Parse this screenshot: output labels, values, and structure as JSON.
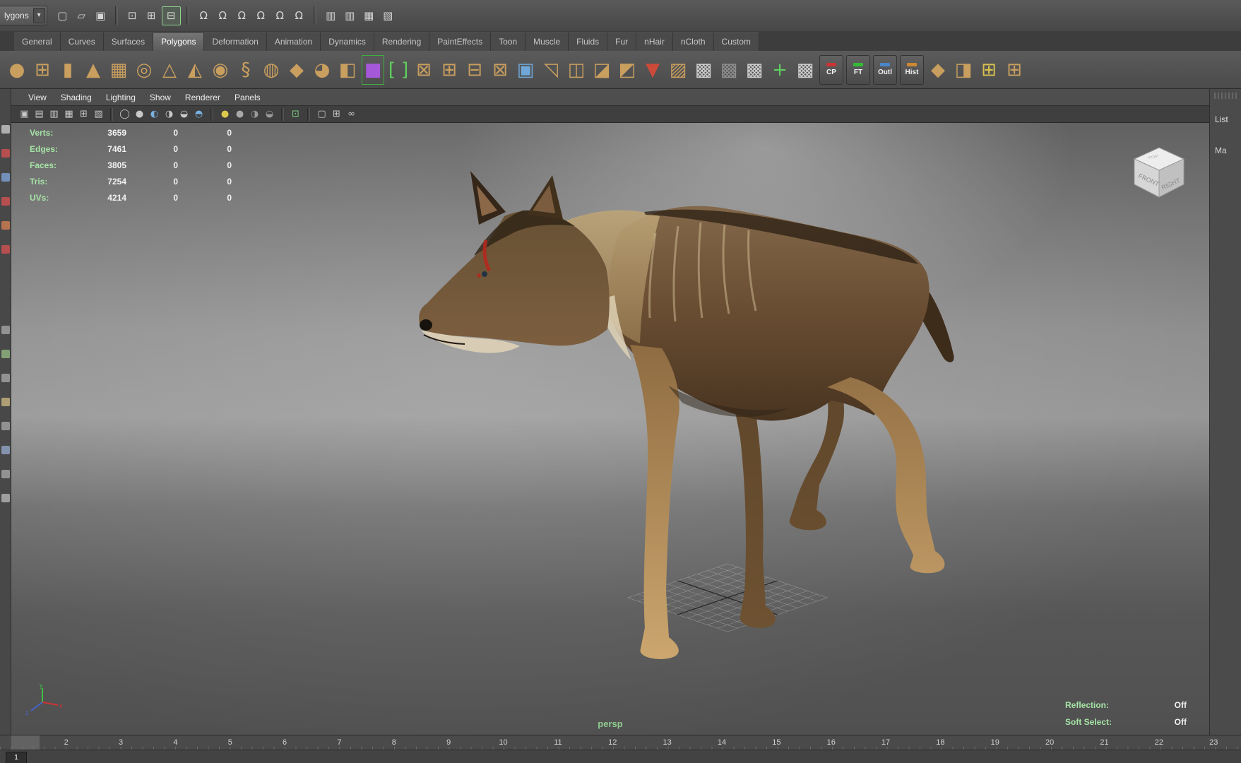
{
  "toolbar": {
    "menu_set_visible": "lygons",
    "menu_arrow": "▾",
    "groups": [
      {
        "icons": [
          {
            "name": "new-scene-icon",
            "glyph": "▢"
          },
          {
            "name": "open-scene-icon",
            "glyph": "▱"
          },
          {
            "name": "save-scene-icon",
            "glyph": "▣"
          }
        ]
      },
      {
        "icons": [
          {
            "name": "select-hierarchy-icon",
            "glyph": "⊡"
          },
          {
            "name": "select-object-icon",
            "glyph": "⊞"
          },
          {
            "name": "select-component-icon",
            "glyph": "⊟",
            "boxed": true
          }
        ]
      },
      {
        "icons": [
          {
            "name": "snap-grid-icon",
            "glyph": "Ω"
          },
          {
            "name": "snap-curve-icon",
            "glyph": "Ω"
          },
          {
            "name": "snap-point-icon",
            "glyph": "Ω"
          },
          {
            "name": "snap-projected-center-icon",
            "glyph": "Ω"
          },
          {
            "name": "snap-view-plane-icon",
            "glyph": "Ω"
          },
          {
            "name": "make-live-icon",
            "glyph": "Ω"
          }
        ]
      },
      {
        "icons": [
          {
            "name": "input-connections-icon",
            "glyph": "▥"
          },
          {
            "name": "output-connections-icon",
            "glyph": "▥"
          },
          {
            "name": "construction-history-icon",
            "glyph": "▦"
          },
          {
            "name": "render-view-icon",
            "glyph": "▧"
          }
        ]
      }
    ]
  },
  "shelf": {
    "tabs": [
      "General",
      "Curves",
      "Surfaces",
      "Polygons",
      "Deformation",
      "Animation",
      "Dynamics",
      "Rendering",
      "PaintEffects",
      "Toon",
      "Muscle",
      "Fluids",
      "Fur",
      "nHair",
      "nCloth",
      "Custom"
    ],
    "active_tab": "Polygons",
    "default_icon_color": "#c99f5f",
    "icons": [
      {
        "name": "poly-sphere-icon",
        "glyph": "●"
      },
      {
        "name": "poly-cube-icon",
        "glyph": "⊞"
      },
      {
        "name": "poly-cylinder-icon",
        "glyph": "▮"
      },
      {
        "name": "poly-cone-icon",
        "glyph": "▲"
      },
      {
        "name": "poly-plane-icon",
        "glyph": "▦"
      },
      {
        "name": "poly-torus-icon",
        "glyph": "◎"
      },
      {
        "name": "poly-prism-icon",
        "glyph": "△"
      },
      {
        "name": "poly-pyramid-icon",
        "glyph": "◭"
      },
      {
        "name": "poly-pipe-icon",
        "glyph": "◉"
      },
      {
        "name": "poly-helix-icon",
        "glyph": "§"
      },
      {
        "name": "poly-soccer-ball-icon",
        "glyph": "◍"
      },
      {
        "name": "poly-platonic-icon",
        "glyph": "◆"
      },
      {
        "name": "sculpt-tool-icon",
        "glyph": "◕"
      },
      {
        "name": "poly-mirror-icon",
        "glyph": "◧"
      },
      {
        "name": "poly-texture-cube-icon",
        "glyph": "■",
        "color": "#a558d8",
        "highlight": true
      },
      {
        "name": "poly-brackets-icon",
        "glyph": "[ ]",
        "color": "#5ecf5e"
      },
      {
        "name": "select-cube-icon",
        "glyph": "⊠"
      },
      {
        "name": "poly-combine-icon",
        "glyph": "⊞"
      },
      {
        "name": "poly-separate-icon",
        "glyph": "⊟"
      },
      {
        "name": "poly-extract-icon",
        "glyph": "⊠"
      },
      {
        "name": "poly-fill-hole-icon",
        "glyph": "▣",
        "color": "#6fa8d8"
      },
      {
        "name": "poly-extrude-icon",
        "glyph": "◹"
      },
      {
        "name": "poly-bridge-icon",
        "glyph": "◫"
      },
      {
        "name": "poly-bevel-icon",
        "glyph": "◪"
      },
      {
        "name": "poly-crease-icon",
        "glyph": "◩"
      },
      {
        "name": "poly-reduce-icon",
        "glyph": "▼",
        "color": "#cc4a3a"
      },
      {
        "name": "transfer-attributes-icon",
        "glyph": "▨"
      },
      {
        "name": "uv-checker-icon",
        "glyph": "▩",
        "color": "#cfcfcf"
      },
      {
        "name": "uv-snapshot-icon",
        "glyph": "▩",
        "color": "#8f8f8f"
      },
      {
        "name": "uv-editor-icon",
        "glyph": "▩",
        "color": "#cfcfcf"
      },
      {
        "name": "uv-move-icon",
        "glyph": "+",
        "color": "#5ecf5e"
      },
      {
        "name": "uv-grid-icon",
        "glyph": "▩",
        "color": "#cfcfcf"
      },
      {
        "name": "cp-button",
        "kind": "button",
        "label": "CP",
        "accent": "#cc3333"
      },
      {
        "name": "ft-button",
        "kind": "button",
        "label": "FT",
        "accent": "#33bb33"
      },
      {
        "name": "outl-button",
        "kind": "button",
        "label": "Outl",
        "accent": "#4a86c8"
      },
      {
        "name": "hist-button",
        "kind": "button",
        "label": "Hist",
        "accent": "#cc8833"
      },
      {
        "name": "poly-spin-edge-icon",
        "glyph": "◆"
      },
      {
        "name": "poly-flip-icon",
        "glyph": "◨"
      },
      {
        "name": "poly-project-icon",
        "glyph": "⊞",
        "color": "#d8c050"
      },
      {
        "name": "poly-quad-strip-icon",
        "glyph": "⊞"
      }
    ]
  },
  "left_toolbar": {
    "groups": [
      [
        {
          "name": "select-tool-icon",
          "color": "#b8b8b8"
        },
        {
          "name": "lasso-tool-icon",
          "color": "#c25050"
        },
        {
          "name": "paint-select-tool-icon",
          "color": "#7898c8"
        },
        {
          "name": "move-tool-icon",
          "color": "#c25050"
        },
        {
          "name": "rotate-tool-icon",
          "color": "#c27850"
        },
        {
          "name": "scale-tool-icon",
          "color": "#c25050"
        }
      ],
      [
        {
          "name": "toolbox-item-a-icon",
          "color": "#9a9a9a"
        },
        {
          "name": "toolbox-item-b-icon",
          "color": "#8aa87a"
        },
        {
          "name": "toolbox-item-c-icon",
          "color": "#9a9a9a"
        },
        {
          "name": "toolbox-item-d-icon",
          "color": "#b8a878"
        },
        {
          "name": "toolbox-item-e-icon",
          "color": "#9a9a9a"
        },
        {
          "name": "toolbox-item-f-icon",
          "color": "#8a9ab8"
        },
        {
          "name": "toolbox-item-g-icon",
          "color": "#9a9a9a"
        },
        {
          "name": "toolbox-item-h-icon",
          "color": "#a8a8a8"
        }
      ]
    ]
  },
  "panel": {
    "menu": [
      "View",
      "Shading",
      "Lighting",
      "Show",
      "Renderer",
      "Panels"
    ],
    "icon_groups": [
      {
        "icons": [
          {
            "name": "camera-select-icon",
            "glyph": "▣"
          },
          {
            "name": "camera-attributes-icon",
            "glyph": "▤"
          },
          {
            "name": "bookmark-icon",
            "glyph": "▥"
          },
          {
            "name": "image-plane-icon",
            "glyph": "▦"
          },
          {
            "name": "pan-zoom-icon",
            "glyph": "⊞"
          },
          {
            "name": "grease-pencil-icon",
            "glyph": "▧"
          }
        ]
      },
      {
        "icons": [
          {
            "name": "wireframe-icon",
            "glyph": "◯"
          },
          {
            "name": "smooth-shade-icon",
            "glyph": "●"
          },
          {
            "name": "textured-icon",
            "glyph": "◐",
            "color": "#7ab0e0"
          },
          {
            "name": "use-default-material-icon",
            "glyph": "◑"
          },
          {
            "name": "xray-icon",
            "glyph": "◒"
          },
          {
            "name": "wireframe-on-shaded-icon",
            "glyph": "◓",
            "color": "#7ab0e0"
          }
        ]
      },
      {
        "icons": [
          {
            "name": "default-light-icon",
            "glyph": "●",
            "color": "#ddc94e"
          },
          {
            "name": "all-lights-icon",
            "glyph": "●",
            "color": "#a8a8a8"
          },
          {
            "name": "shadows-icon",
            "glyph": "◑",
            "color": "#9a9a9a"
          },
          {
            "name": "ambient-occlusion-icon",
            "glyph": "◒",
            "color": "#9a9a9a"
          }
        ]
      },
      {
        "icons": [
          {
            "name": "highlight-selection-icon",
            "glyph": "⊡",
            "color": "#7fd27f"
          }
        ]
      },
      {
        "icons": [
          {
            "name": "isolate-select-icon",
            "glyph": "▢"
          },
          {
            "name": "subdiv-display-icon",
            "glyph": "⊞"
          },
          {
            "name": "share-edits-icon",
            "glyph": "∞"
          }
        ]
      }
    ]
  },
  "hud": {
    "rows": [
      {
        "label": "Verts:",
        "values": [
          "3659",
          "0",
          "0"
        ]
      },
      {
        "label": "Edges:",
        "values": [
          "7461",
          "0",
          "0"
        ]
      },
      {
        "label": "Faces:",
        "values": [
          "3805",
          "0",
          "0"
        ]
      },
      {
        "label": "Tris:",
        "values": [
          "7254",
          "0",
          "0"
        ]
      },
      {
        "label": "UVs:",
        "values": [
          "4214",
          "0",
          "0"
        ]
      }
    ]
  },
  "viewport": {
    "camera_label": "persp",
    "reflection_label": "Reflection:",
    "reflection_value": "Off",
    "soft_select_label": "Soft Select:",
    "soft_select_value": "Off",
    "viewcube": {
      "top": "TOP",
      "front": "FRONT",
      "right": "RIGHT"
    }
  },
  "right_panel": {
    "items": [
      "List",
      "Ma"
    ]
  },
  "timeline": {
    "frames": [
      "2",
      "3",
      "4",
      "5",
      "6",
      "7",
      "8",
      "9",
      "10",
      "11",
      "12",
      "13",
      "14",
      "15",
      "16",
      "17",
      "18",
      "19",
      "20",
      "21",
      "22",
      "23"
    ],
    "range_start": "1"
  },
  "colors": {
    "hud_green": "#a6e3a6",
    "accent_green": "#3fae3f"
  }
}
